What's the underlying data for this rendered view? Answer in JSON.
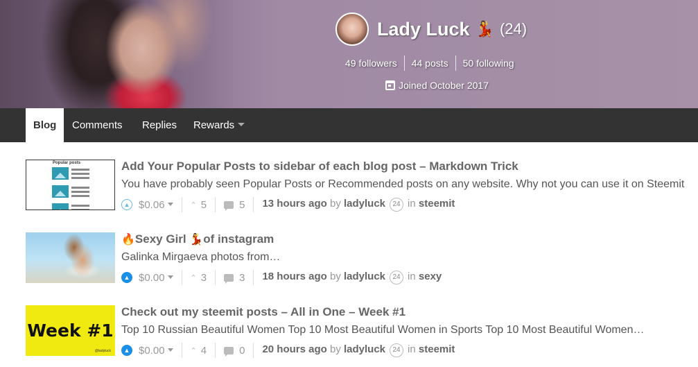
{
  "profile": {
    "name": "Lady Luck",
    "name_emoji": "💃",
    "reputation": "(24)",
    "followers": "49 followers",
    "posts": "44 posts",
    "following": "50 following",
    "joined": "Joined October 2017"
  },
  "tabs": [
    {
      "label": "Blog",
      "active": true
    },
    {
      "label": "Comments"
    },
    {
      "label": "Replies"
    },
    {
      "label": "Rewards"
    }
  ],
  "posts": [
    {
      "title": "Add Your Popular Posts to sidebar of each blog post – Markdown Trick",
      "summary": "You have probably seen Popular Posts or Recommended posts on any website. Why not you can use it on Steemit",
      "payout": "$0.06",
      "votes": "5",
      "comments": "5",
      "time": "13 hours ago",
      "by": "by",
      "author": "ladyluck",
      "author_rep": "24",
      "in": "in",
      "category": "steemit",
      "thumb_label": "Popular posts"
    },
    {
      "title_prefix": "🔥",
      "title_a": "Sexy Girl ",
      "title_emoji": "💃",
      "title_b": "of instagram",
      "summary": "Galinka Mirgaeva photos from…",
      "payout": "$0.00",
      "votes": "3",
      "comments": "3",
      "time": "18 hours ago",
      "by": "by",
      "author": "ladyluck",
      "author_rep": "24",
      "in": "in",
      "category": "sexy"
    },
    {
      "title": "Check out my steemit posts – All in One – Week #1",
      "summary": "Top 10 Russian Beautiful Women Top 10 Most Beautiful Women in Sports Top 10 Most Beautiful Women…",
      "payout": "$0.00",
      "votes": "4",
      "comments": "0",
      "time": "20 hours ago",
      "by": "by",
      "author": "ladyluck",
      "author_rep": "24",
      "in": "in",
      "category": "steemit",
      "thumb_text": "Week #1",
      "thumb_tag": "@ladyluck"
    }
  ],
  "icons": {
    "vote": "chevron-up-circle-icon",
    "votes": "chevron-up-icon",
    "comments": "comment-icon",
    "calendar": "calendar-icon"
  },
  "colors": {
    "tabbar": "#333333",
    "vote_accent": "#1a8fe8"
  }
}
